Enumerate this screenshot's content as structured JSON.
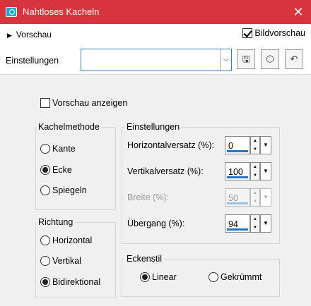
{
  "window": {
    "title": "Nahtloses Kacheln",
    "close_glyph": "✕"
  },
  "top": {
    "preview_label": "Vorschau",
    "preview_arrow": "▶",
    "image_preview_label": "Bildvorschau",
    "image_preview_checked": true
  },
  "settings_bar": {
    "label": "Einstellungen",
    "preset_value": "",
    "combo_arrow": "⌵"
  },
  "toolbar": {
    "save_glyph": "🖫",
    "cube_glyph": "⬡",
    "reset_glyph": "↶"
  },
  "preview_checkbox": {
    "label": "Vorschau anzeigen",
    "checked": false
  },
  "tile_method": {
    "title": "Kachelmethode",
    "options": [
      {
        "label": "Kante",
        "selected": false
      },
      {
        "label": "Ecke",
        "selected": true
      },
      {
        "label": "Spiegeln",
        "selected": false
      }
    ]
  },
  "settings": {
    "title": "Einstellungen",
    "fields": [
      {
        "label": "Horizontalversatz (%):",
        "value": "0",
        "disabled": false
      },
      {
        "label": "Vertikalversatz (%):",
        "value": "100",
        "disabled": false
      },
      {
        "label": "Breite (%):",
        "value": "50",
        "disabled": true
      },
      {
        "label": "Übergang (%):",
        "value": "94",
        "disabled": false
      }
    ],
    "spin_up": "▲",
    "spin_down": "▼",
    "drop_glyph": "▼"
  },
  "direction": {
    "title": "Richtung",
    "options": [
      {
        "label": "Horizontal",
        "selected": false
      },
      {
        "label": "Vertikal",
        "selected": false
      },
      {
        "label": "Bidirektional",
        "selected": true
      }
    ]
  },
  "corner_style": {
    "title": "Eckenstil",
    "options": [
      {
        "label": "Linear",
        "selected": true
      },
      {
        "label": "Gekrümmt",
        "selected": false
      }
    ]
  }
}
